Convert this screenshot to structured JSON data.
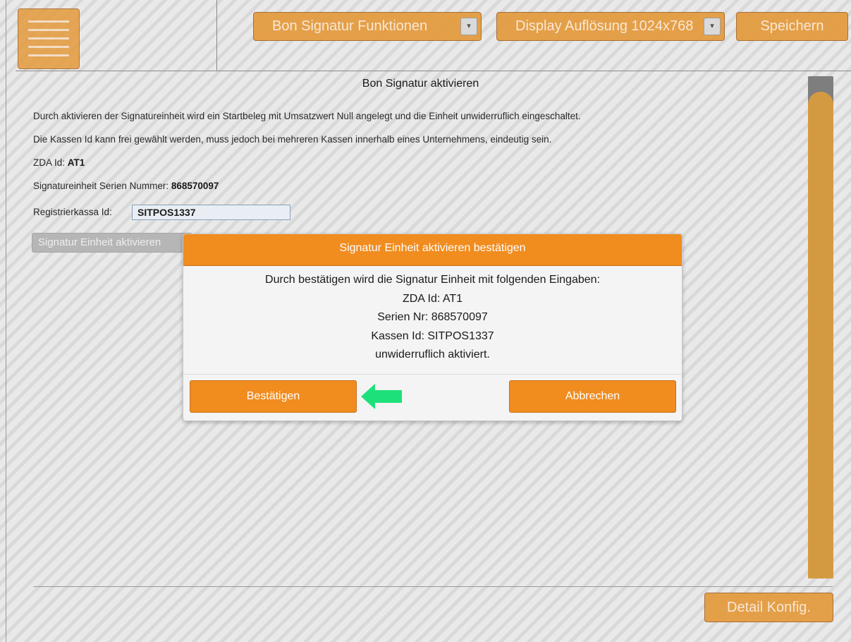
{
  "header": {
    "menu_icon": "hamburger-icon",
    "signature_select": "Bon Signatur Funktionen",
    "display_select": "Display Auflösung 1024x768",
    "dropdown_icon": "▾",
    "save_label": "Speichern"
  },
  "page": {
    "title": "Bon Signatur aktivieren",
    "description_1": "Durch aktivieren der Signatureinheit wird ein Startbeleg mit Umsatzwert Null angelegt und die Einheit unwiderruflich eingeschaltet.",
    "description_2": "Die Kassen Id kann frei gewählt werden, muss jedoch bei mehreren Kassen innerhalb eines Unternehmens, eindeutig sein.",
    "zda_label": "ZDA Id:",
    "zda_value": "AT1",
    "serial_label": "Signatureinheit Serien Nummer:",
    "serial_value": "868570097",
    "kasse_label": "Registrierkassa Id:",
    "kasse_value": "SITPOS1337",
    "activate_button": "Signatur Einheit aktivieren"
  },
  "footer": {
    "detail_button": "Detail Konfig."
  },
  "dialog": {
    "title": "Signatur Einheit aktivieren bestätigen",
    "lines": [
      "Durch bestätigen wird die Signatur Einheit mit folgenden Eingaben:",
      "ZDA Id: AT1",
      "Serien Nr: 868570097",
      "Kassen Id: SITPOS1337",
      "unwiderruflich aktiviert."
    ],
    "confirm_label": "Bestätigen",
    "cancel_label": "Abbrechen"
  },
  "colors": {
    "accent": "#f18c1f",
    "arrow": "#1ee07a"
  }
}
